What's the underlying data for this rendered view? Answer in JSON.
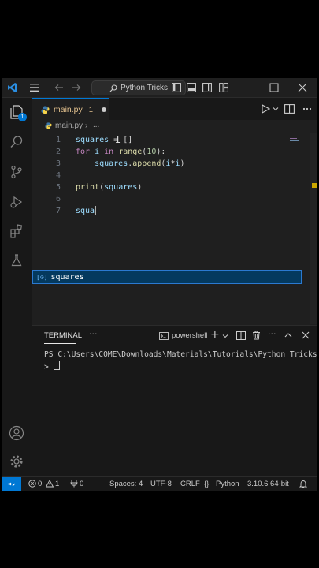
{
  "titlebar": {
    "command_center": "Python Tricks"
  },
  "tab": {
    "filename": "main.py",
    "problems_count": "1"
  },
  "breadcrumb": {
    "file": "main.py",
    "more": "..."
  },
  "editor": {
    "lines": [
      {
        "num": "1",
        "segments": [
          [
            "var",
            "squares"
          ],
          [
            "op",
            " = "
          ],
          [
            "op",
            "[]"
          ]
        ]
      },
      {
        "num": "2",
        "segments": [
          [
            "kw",
            "for"
          ],
          [
            "var",
            " i "
          ],
          [
            "kw",
            "in"
          ],
          [
            "fn",
            " range"
          ],
          [
            "op",
            "("
          ],
          [
            "num",
            "10"
          ],
          [
            "op",
            "):"
          ]
        ]
      },
      {
        "num": "3",
        "segments": [
          [
            "var",
            "    squares"
          ],
          [
            "op",
            "."
          ],
          [
            "fn",
            "append"
          ],
          [
            "op",
            "("
          ],
          [
            "var",
            "i"
          ],
          [
            "op",
            "*"
          ],
          [
            "var",
            "i"
          ],
          [
            "op",
            ")"
          ]
        ]
      },
      {
        "num": "4",
        "segments": []
      },
      {
        "num": "5",
        "segments": [
          [
            "fn",
            "print"
          ],
          [
            "op",
            "("
          ],
          [
            "var",
            "squares"
          ],
          [
            "op",
            ")"
          ]
        ]
      },
      {
        "num": "6",
        "segments": []
      },
      {
        "num": "7",
        "segments": [
          [
            "var",
            "squa"
          ]
        ]
      }
    ],
    "suggestion": {
      "icon_label": "[⊘]",
      "text": "squares"
    }
  },
  "panel": {
    "tab_label": "TERMINAL",
    "more": "···",
    "shell": "powershell",
    "terminal_lines": [
      "PS C:\\Users\\COME\\Downloads\\Materials\\Tutorials\\Python Tricks",
      "> "
    ]
  },
  "status": {
    "errors": "0",
    "warnings": "1",
    "ports": "0",
    "spaces": "Spaces: 4",
    "encoding": "UTF-8",
    "eol": "CRLF",
    "language": "Python",
    "interpreter": "3.10.6 64-bit"
  },
  "activity": {
    "explorer_badge": "1"
  },
  "colors": {
    "accent": "#0078d4",
    "background": "#1f1f1f",
    "bar": "#181818"
  }
}
